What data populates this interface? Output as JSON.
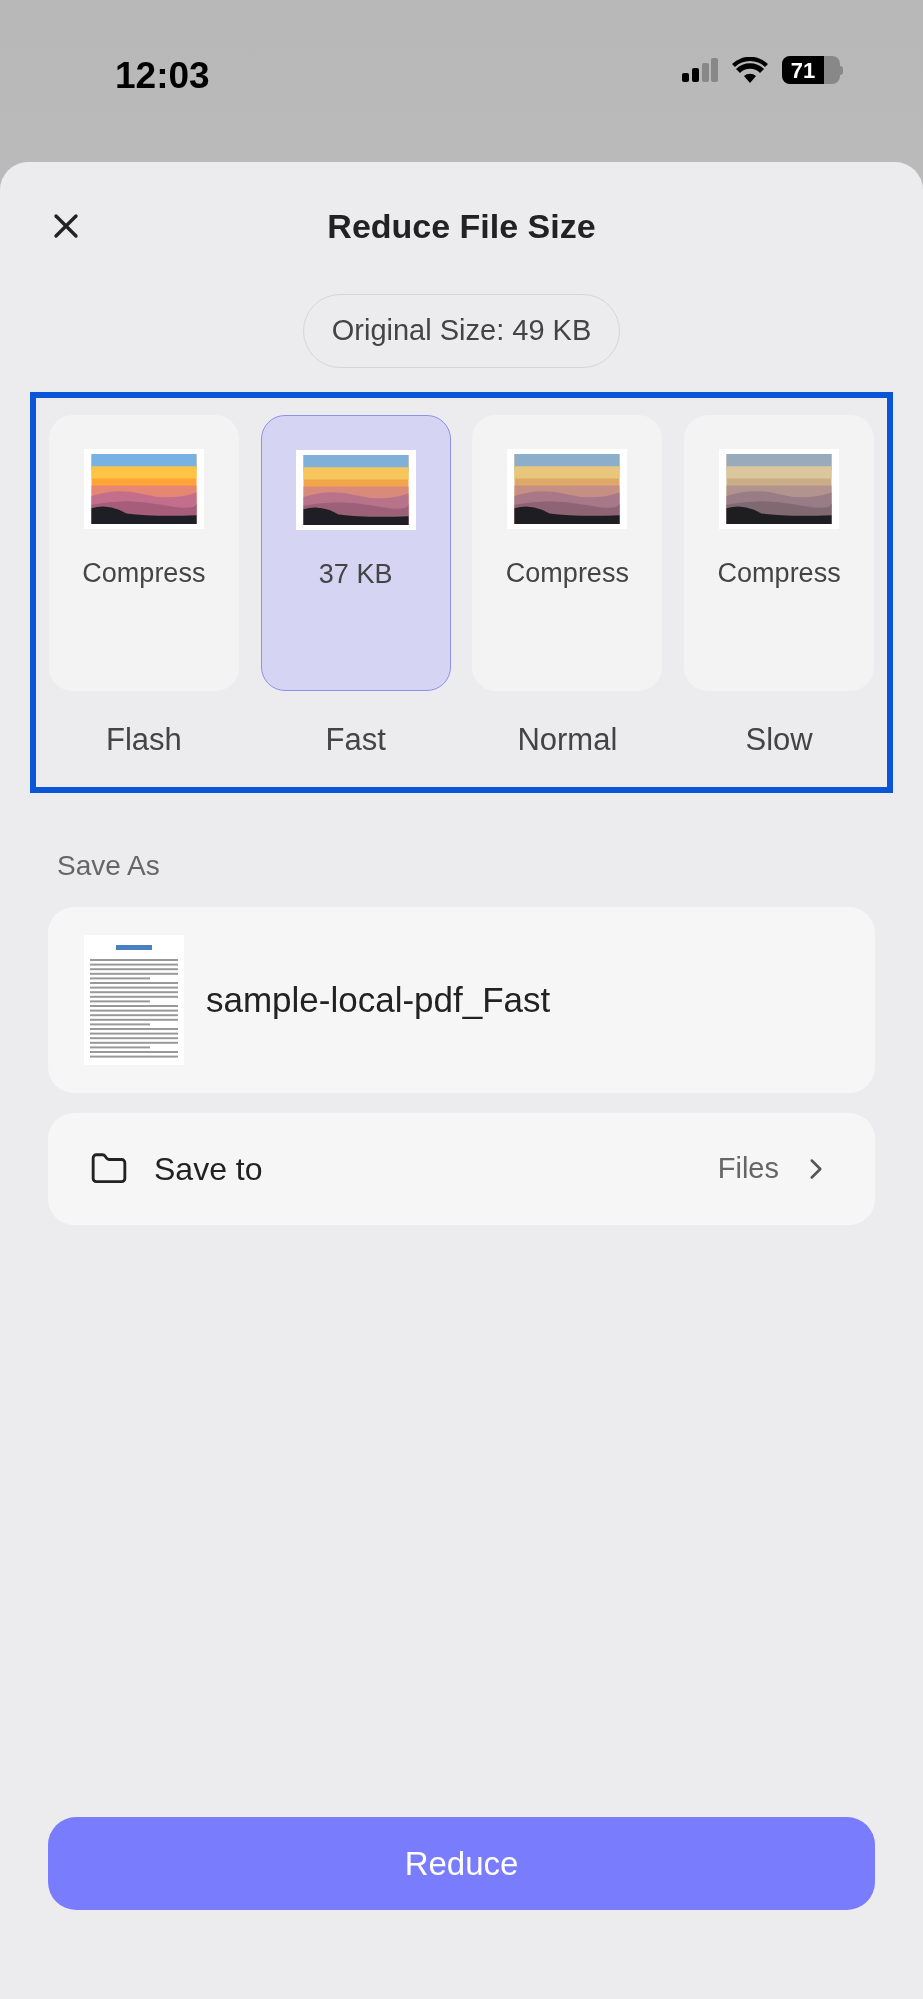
{
  "status_bar": {
    "time": "12:03",
    "battery": "71"
  },
  "sheet": {
    "title": "Reduce File Size",
    "original_size": "Original Size: 49 KB"
  },
  "options": [
    {
      "label": "Compress",
      "name": "Flash",
      "selected": false
    },
    {
      "label": "37 KB",
      "name": "Fast",
      "selected": true
    },
    {
      "label": "Compress",
      "name": "Normal",
      "selected": false
    },
    {
      "label": "Compress",
      "name": "Slow",
      "selected": false
    }
  ],
  "save_as": {
    "label": "Save As",
    "filename": "sample-local-pdf_Fast"
  },
  "save_to": {
    "label": "Save to",
    "value": "Files"
  },
  "button": "Reduce"
}
